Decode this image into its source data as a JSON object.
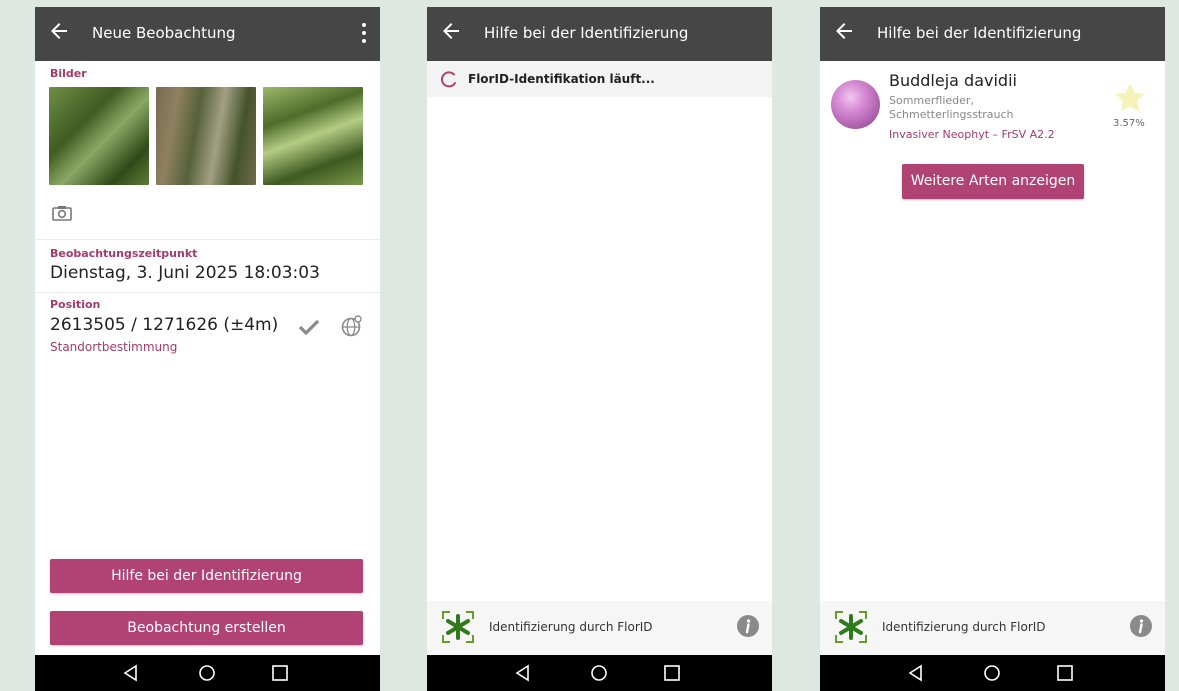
{
  "colors": {
    "accent": "#b04374",
    "appbar": "#464646",
    "label": "#a23c69"
  },
  "screen1": {
    "title": "Neue Beobachtung",
    "images_label": "Bilder",
    "time_label": "Beobachtungszeitpunkt",
    "time_value": "Dienstag, 3. Juni 2025 18:03:03",
    "position_label": "Position",
    "position_value": "2613505 / 1271626 (±4m)",
    "position_sub": "Standortbestimmung",
    "help_button": "Hilfe bei der Identifizierung",
    "create_button": "Beobachtung erstellen"
  },
  "screen2": {
    "title": "Hilfe bei der Identifizierung",
    "progress_text": "FlorID-Identifikation läuft...",
    "footer_text": "Identifizierung durch FlorID"
  },
  "screen3": {
    "title": "Hilfe bei der Identifizierung",
    "species_name": "Buddleja davidii",
    "common_name_1": "Sommerflieder,",
    "common_name_2": "Schmetterlingsstrauch",
    "status": "Invasiver Neophyt – FrSV A2.2",
    "score": "3.57%",
    "more_button": "Weitere Arten anzeigen",
    "footer_text": "Identifizierung durch FlorID"
  }
}
